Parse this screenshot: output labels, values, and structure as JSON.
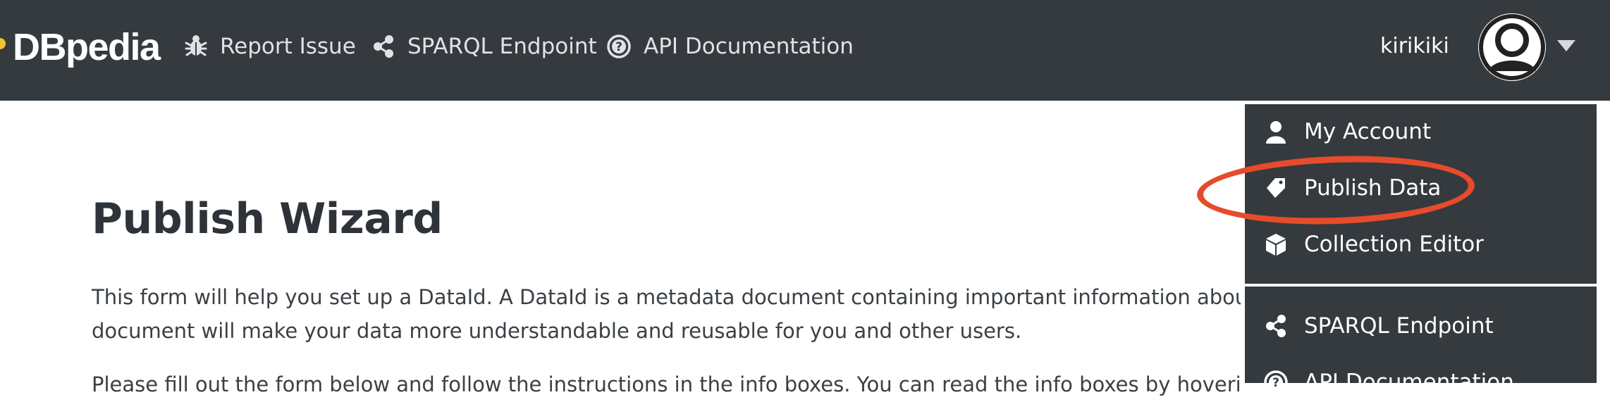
{
  "navbar": {
    "logo": "DBpedia",
    "links": [
      {
        "label": "Report Issue",
        "icon": "bug-icon"
      },
      {
        "label": "SPARQL Endpoint",
        "icon": "share-nodes-icon"
      },
      {
        "label": "API Documentation",
        "icon": "question-circle-icon"
      }
    ],
    "username": "kirikiki"
  },
  "user_menu": {
    "items": [
      {
        "label": "My Account",
        "icon": "user-icon"
      },
      {
        "label": "Publish Data",
        "icon": "tag-icon"
      },
      {
        "label": "Collection Editor",
        "icon": "box-icon"
      },
      {
        "label": "SPARQL Endpoint",
        "icon": "share-nodes-icon"
      },
      {
        "label": "API Documentation",
        "icon": "question-circle-icon"
      }
    ]
  },
  "main": {
    "title": "Publish Wizard",
    "paragraph1_line1": "This form will help you set up a DataId. A DataId is a metadata document containing important information about your f",
    "paragraph1_line2": "document will make your data more understandable and reusable for you and other users.",
    "paragraph2_line1": "Please fill out the form below and follow the instructions in the info boxes. You can read the info boxes by hovering the i"
  },
  "colors": {
    "navbar_bg": "#353a3f",
    "highlight": "#e64b2b",
    "logo_dot": "#f1c232"
  }
}
